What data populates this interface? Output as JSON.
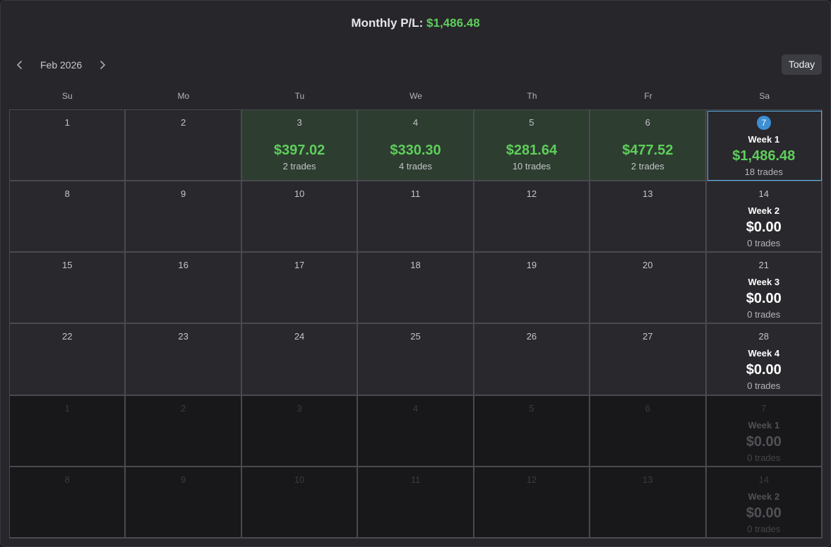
{
  "header": {
    "label": "Monthly P/L:",
    "value": "$1,486.48"
  },
  "nav": {
    "prev_icon": "chevron-left-icon",
    "next_icon": "chevron-right-icon",
    "month": "Feb 2026",
    "today_label": "Today"
  },
  "weekdays": [
    "Su",
    "Mo",
    "Tu",
    "We",
    "Th",
    "Fr",
    "Sa"
  ],
  "colors": {
    "profit": "#5fce5b",
    "profit_cell_bg": "#2d3d30",
    "today_badge": "#3d8fd4",
    "today_outline": "#58b6e8"
  },
  "weeks": [
    {
      "days": [
        {
          "day": "1"
        },
        {
          "day": "2"
        },
        {
          "day": "3",
          "amount": "$397.02",
          "trades": "2 trades"
        },
        {
          "day": "4",
          "amount": "$330.30",
          "trades": "4 trades"
        },
        {
          "day": "5",
          "amount": "$281.64",
          "trades": "10 trades"
        },
        {
          "day": "6",
          "amount": "$477.52",
          "trades": "2 trades"
        }
      ],
      "summary": {
        "day": "7",
        "label": "Week 1",
        "amount": "$1,486.48",
        "trades": "18 trades",
        "positive": true,
        "today": true
      }
    },
    {
      "days": [
        {
          "day": "8"
        },
        {
          "day": "9"
        },
        {
          "day": "10"
        },
        {
          "day": "11"
        },
        {
          "day": "12"
        },
        {
          "day": "13"
        }
      ],
      "summary": {
        "day": "14",
        "label": "Week 2",
        "amount": "$0.00",
        "trades": "0 trades"
      }
    },
    {
      "days": [
        {
          "day": "15"
        },
        {
          "day": "16"
        },
        {
          "day": "17"
        },
        {
          "day": "18"
        },
        {
          "day": "19"
        },
        {
          "day": "20"
        }
      ],
      "summary": {
        "day": "21",
        "label": "Week 3",
        "amount": "$0.00",
        "trades": "0 trades"
      }
    },
    {
      "days": [
        {
          "day": "22"
        },
        {
          "day": "23"
        },
        {
          "day": "24"
        },
        {
          "day": "25"
        },
        {
          "day": "26"
        },
        {
          "day": "27"
        }
      ],
      "summary": {
        "day": "28",
        "label": "Week 4",
        "amount": "$0.00",
        "trades": "0 trades"
      }
    },
    {
      "outside": true,
      "days": [
        {
          "day": "1"
        },
        {
          "day": "2"
        },
        {
          "day": "3"
        },
        {
          "day": "4"
        },
        {
          "day": "5"
        },
        {
          "day": "6"
        }
      ],
      "summary": {
        "day": "7",
        "label": "Week 1",
        "amount": "$0.00",
        "trades": "0 trades"
      }
    },
    {
      "outside": true,
      "days": [
        {
          "day": "8"
        },
        {
          "day": "9"
        },
        {
          "day": "10"
        },
        {
          "day": "11"
        },
        {
          "day": "12"
        },
        {
          "day": "13"
        }
      ],
      "summary": {
        "day": "14",
        "label": "Week 2",
        "amount": "$0.00",
        "trades": "0 trades"
      }
    }
  ]
}
